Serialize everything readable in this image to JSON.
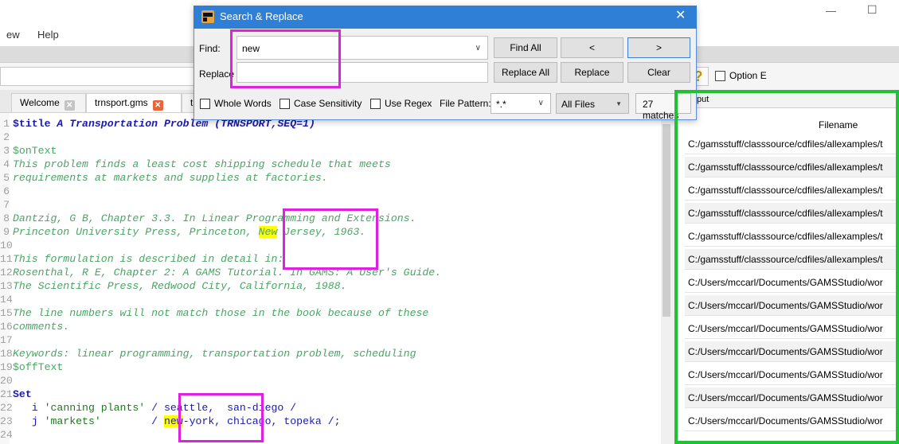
{
  "window": {
    "controls": {
      "minimize": "—",
      "maximize": "☐"
    }
  },
  "menu": {
    "view_partial": "ew",
    "help": "Help"
  },
  "command_bar": {
    "help_symbol": "?",
    "option_label": "Option E"
  },
  "tabs": [
    {
      "label": "Welcome",
      "active": false
    },
    {
      "label": "trnsport.gms",
      "active": true
    },
    {
      "label": "tr",
      "active": false
    }
  ],
  "dialog": {
    "title": "Search & Replace",
    "close": "✕",
    "find_label": "Find:",
    "find_value": "new",
    "replace_label": "Replace",
    "replace_value": "",
    "buttons": {
      "find_all": "Find All",
      "prev": "<",
      "next": ">",
      "replace_all": "Replace All",
      "replace": "Replace",
      "clear": "Clear"
    },
    "options": {
      "whole_words": "Whole Words",
      "case_sensitivity": "Case Sensitivity",
      "use_regex": "Use Regex"
    },
    "file_pattern_label": "File Pattern:",
    "file_pattern_value": "*.*",
    "scope_value": "All Files",
    "matches": "27 matches"
  },
  "results": {
    "tab_label": "tput",
    "column_header": "Filename",
    "rows": [
      "C:/gamsstuff/classsource/cdfiles/allexamples/t",
      "C:/gamsstuff/classsource/cdfiles/allexamples/t",
      "C:/gamsstuff/classsource/cdfiles/allexamples/t",
      "C:/gamsstuff/classsource/cdfiles/allexamples/t",
      "C:/gamsstuff/classsource/cdfiles/allexamples/t",
      "C:/gamsstuff/classsource/cdfiles/allexamples/t",
      "C:/Users/mccarl/Documents/GAMSStudio/wor",
      "C:/Users/mccarl/Documents/GAMSStudio/wor",
      "C:/Users/mccarl/Documents/GAMSStudio/wor",
      "C:/Users/mccarl/Documents/GAMSStudio/wor",
      "C:/Users/mccarl/Documents/GAMSStudio/wor",
      "C:/Users/mccarl/Documents/GAMSStudio/wor",
      "C:/Users/mccarl/Documents/GAMSStudio/wor"
    ]
  },
  "editor": {
    "line_numbers": [
      "1",
      "2",
      "3",
      "4",
      "5",
      "6",
      "7",
      "8",
      "9",
      "10",
      "11",
      "12",
      "13",
      "14",
      "15",
      "16",
      "17",
      "18",
      "19",
      "20",
      "21",
      "22",
      "23",
      "24"
    ],
    "l1_kw": "$title ",
    "l1_title": "A Transportation Problem (TRNSPORT,SEQ=1)",
    "l3": "$onText",
    "l4": "This problem finds a least cost shipping schedule that meets",
    "l5": "requirements at markets and supplies at factories.",
    "l8": "Dantzig, G B, Chapter 3.3. In Linear Programming and Extensions.",
    "l9_a": "Princeton University Press, Princeton, ",
    "l9_hl": "New",
    "l9_b": " Jersey, 1963.",
    "l11": "This formulation is described in detail in:",
    "l12": "Rosenthal, R E, Chapter 2: A GAMS Tutorial. In GAMS: A User's Guide.",
    "l13": "The Scientific Press, Redwood City, California, 1988.",
    "l15": "The line numbers will not match those in the book because of these",
    "l16": "comments.",
    "l18": "Keywords: linear programming, transportation problem, scheduling",
    "l19": "$offText",
    "l21": "Set",
    "l22_a": "   i ",
    "l22_str": "'canning plants'",
    "l22_b": " / seattle,  san-diego /",
    "l23_a": "   j ",
    "l23_str": "'markets'",
    "l23_b": "        / ",
    "l23_hl": "new",
    "l23_c": "-york, chicago, topeka /;"
  }
}
